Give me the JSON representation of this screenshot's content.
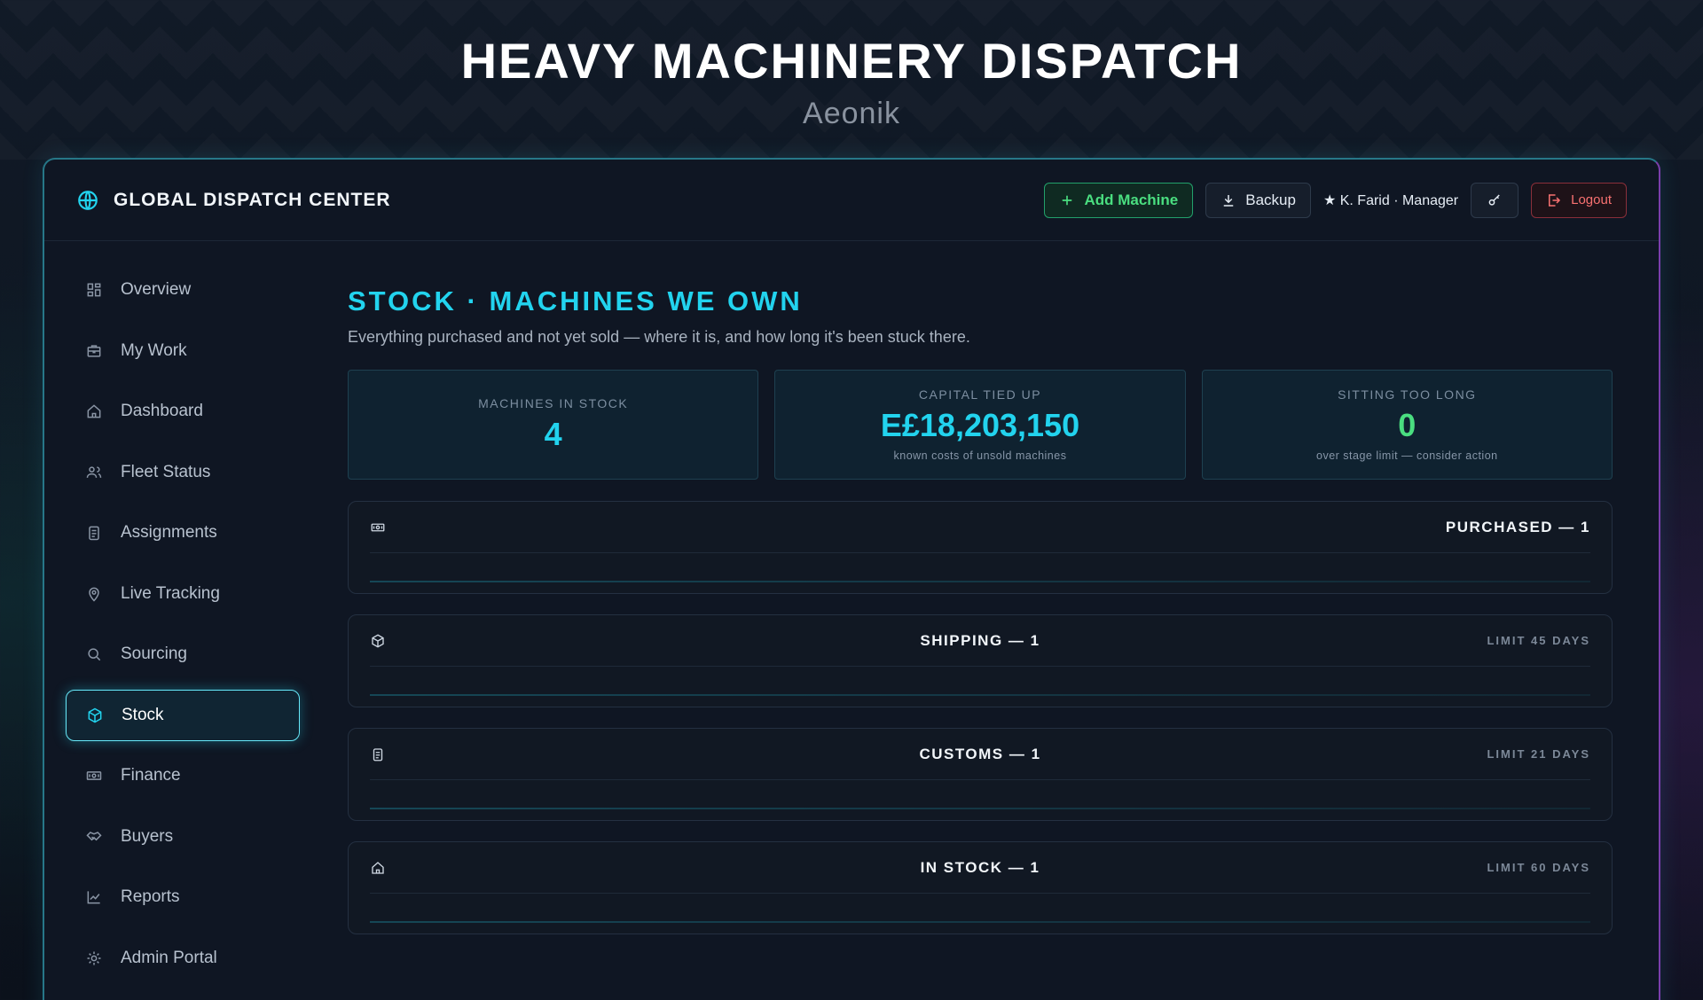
{
  "hero": {
    "title": "HEAVY MACHINERY DISPATCH",
    "subtitle": "Aeonik"
  },
  "header": {
    "app_title": "GLOBAL DISPATCH CENTER",
    "add_label": "Add Machine",
    "backup_label": "Backup",
    "user_label": "★ K. Farid · Manager",
    "logout_label": "Logout"
  },
  "sidebar": {
    "items": [
      {
        "label": "Overview",
        "icon": "grid-icon"
      },
      {
        "label": "My Work",
        "icon": "briefcase-icon"
      },
      {
        "label": "Dashboard",
        "icon": "home-icon"
      },
      {
        "label": "Fleet Status",
        "icon": "users-icon"
      },
      {
        "label": "Assignments",
        "icon": "clipboard-icon"
      },
      {
        "label": "Live Tracking",
        "icon": "map-pin-icon"
      },
      {
        "label": "Sourcing",
        "icon": "search-icon"
      },
      {
        "label": "Stock",
        "icon": "box-icon",
        "active": true
      },
      {
        "label": "Finance",
        "icon": "banknote-icon"
      },
      {
        "label": "Buyers",
        "icon": "handshake-icon"
      },
      {
        "label": "Reports",
        "icon": "chart-icon"
      },
      {
        "label": "Admin Portal",
        "icon": "gear-icon"
      }
    ]
  },
  "main": {
    "title": "STOCK · MACHINES WE OWN",
    "description": "Everything purchased and not yet sold — where it is, and how long it's been stuck there.",
    "stats": [
      {
        "label": "MACHINES IN STOCK",
        "value": "4",
        "note": ""
      },
      {
        "label": "CAPITAL TIED UP",
        "value": "E£18,203,150",
        "note": "known costs of unsold machines"
      },
      {
        "label": "SITTING TOO LONG",
        "value": "0",
        "note": "over stage limit — consider action"
      }
    ],
    "stages": [
      {
        "name": "PURCHASED — 1",
        "limit": "",
        "icon": "banknote-icon"
      },
      {
        "name": "SHIPPING — 1",
        "limit": "LIMIT 45 DAYS",
        "icon": "box-icon"
      },
      {
        "name": "CUSTOMS — 1",
        "limit": "LIMIT 21 DAYS",
        "icon": "clipboard-icon"
      },
      {
        "name": "IN STOCK — 1",
        "limit": "LIMIT 60 DAYS",
        "icon": "home-icon"
      }
    ]
  },
  "colors": {
    "accent": "#22d3ee",
    "success": "#4ade80",
    "danger": "#f87171",
    "background": "#0f1623"
  }
}
